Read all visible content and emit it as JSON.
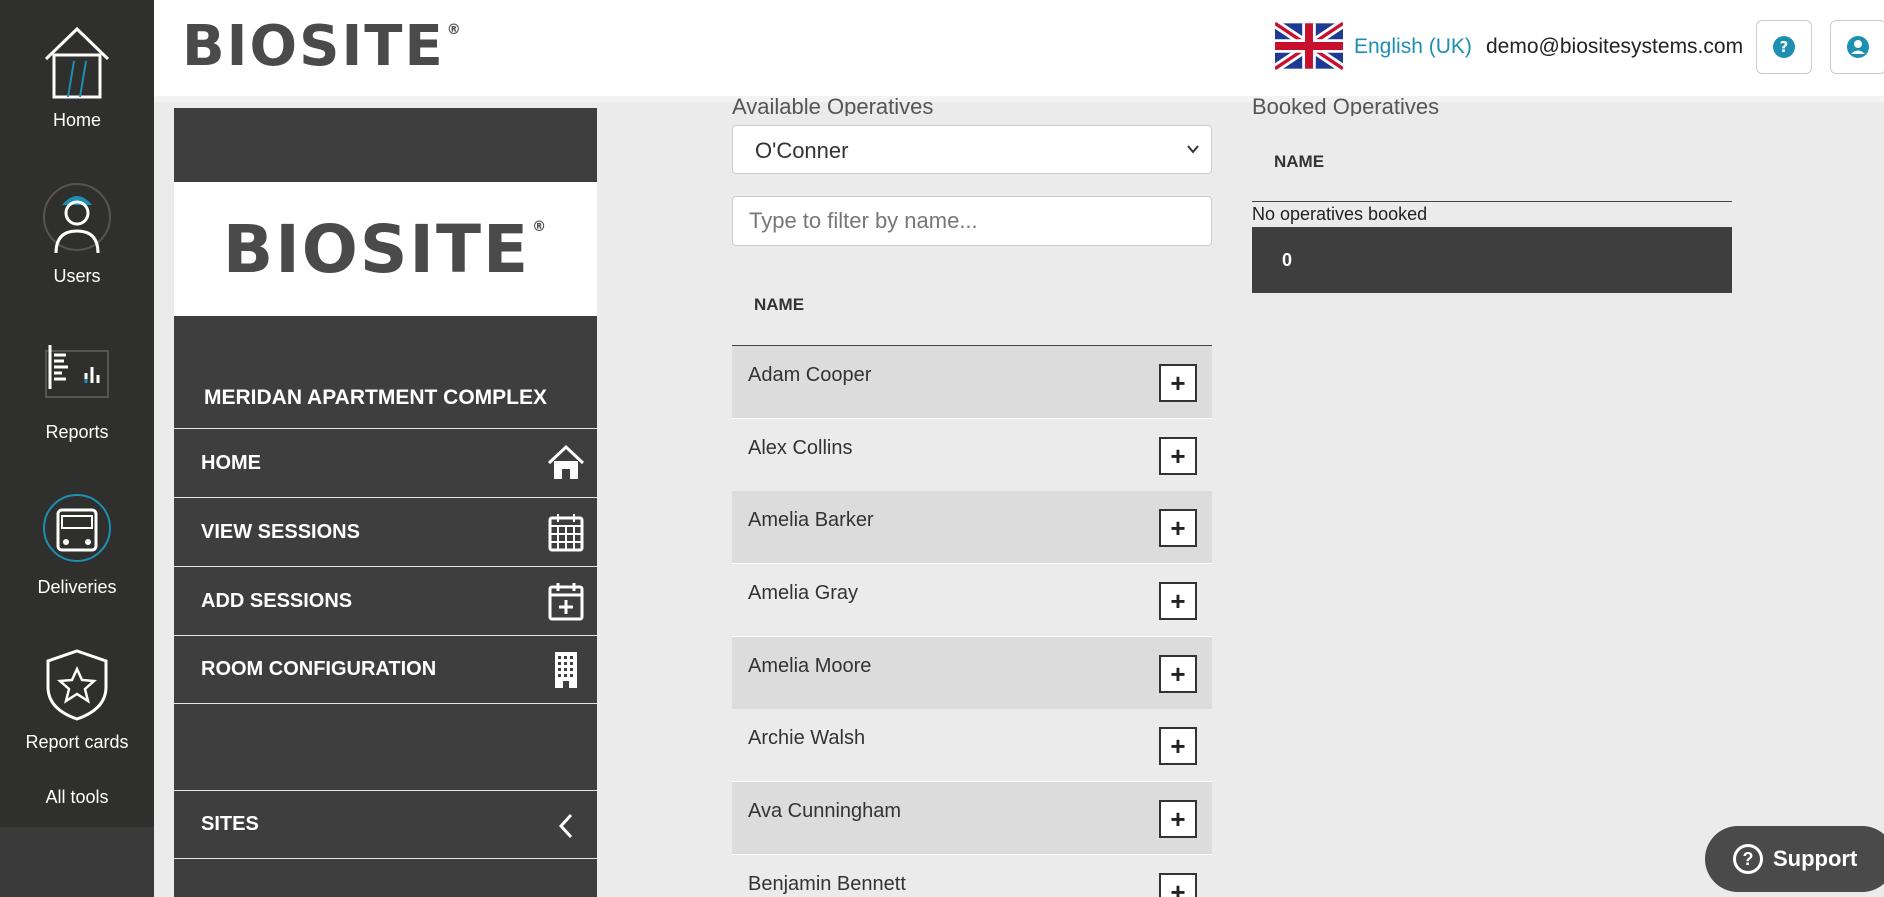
{
  "rail": {
    "items": [
      {
        "label": "Home",
        "icon": "house-icon"
      },
      {
        "label": "Users",
        "icon": "worker-icon"
      },
      {
        "label": "Reports",
        "icon": "report-chart-icon"
      },
      {
        "label": "Deliveries",
        "icon": "truck-icon"
      },
      {
        "label": "Report cards",
        "icon": "shield-star-icon"
      }
    ],
    "all_tools": "All tools"
  },
  "header": {
    "logo": "BIOSITE",
    "logo_mark": "®",
    "language": "English (UK)",
    "email": "demo@biositesystems.com",
    "help_icon": "question-circle-icon",
    "account_icon": "user-circle-icon"
  },
  "side_panel": {
    "logo": "BIOSITE",
    "logo_mark": "®",
    "site_name": "MERIDAN APARTMENT COMPLEX",
    "nav": [
      {
        "label": "HOME",
        "icon": "house-icon"
      },
      {
        "label": "VIEW SESSIONS",
        "icon": "calendar-icon"
      },
      {
        "label": "ADD SESSIONS",
        "icon": "calendar-plus-icon"
      },
      {
        "label": "ROOM CONFIGURATION",
        "icon": "building-icon"
      }
    ],
    "sites_label": "SITES"
  },
  "available": {
    "title": "Available Operatives",
    "selected_company": "O'Conner",
    "filter_placeholder": "Type to filter by name...",
    "column_name": "NAME",
    "add_label": "+",
    "operatives": [
      "Adam Cooper",
      "Alex Collins",
      "Amelia Barker",
      "Amelia Gray",
      "Amelia Moore",
      "Archie Walsh",
      "Ava Cunningham",
      "Benjamin Bennett"
    ]
  },
  "booked": {
    "title": "Booked Operatives",
    "column_name": "NAME",
    "empty_message": "No operatives booked",
    "count": "0"
  },
  "support": {
    "label": "Support"
  },
  "colors": {
    "accent": "#1d8fb0",
    "dark_panel": "#3f3e3e",
    "rail": "#2f2f2e"
  }
}
